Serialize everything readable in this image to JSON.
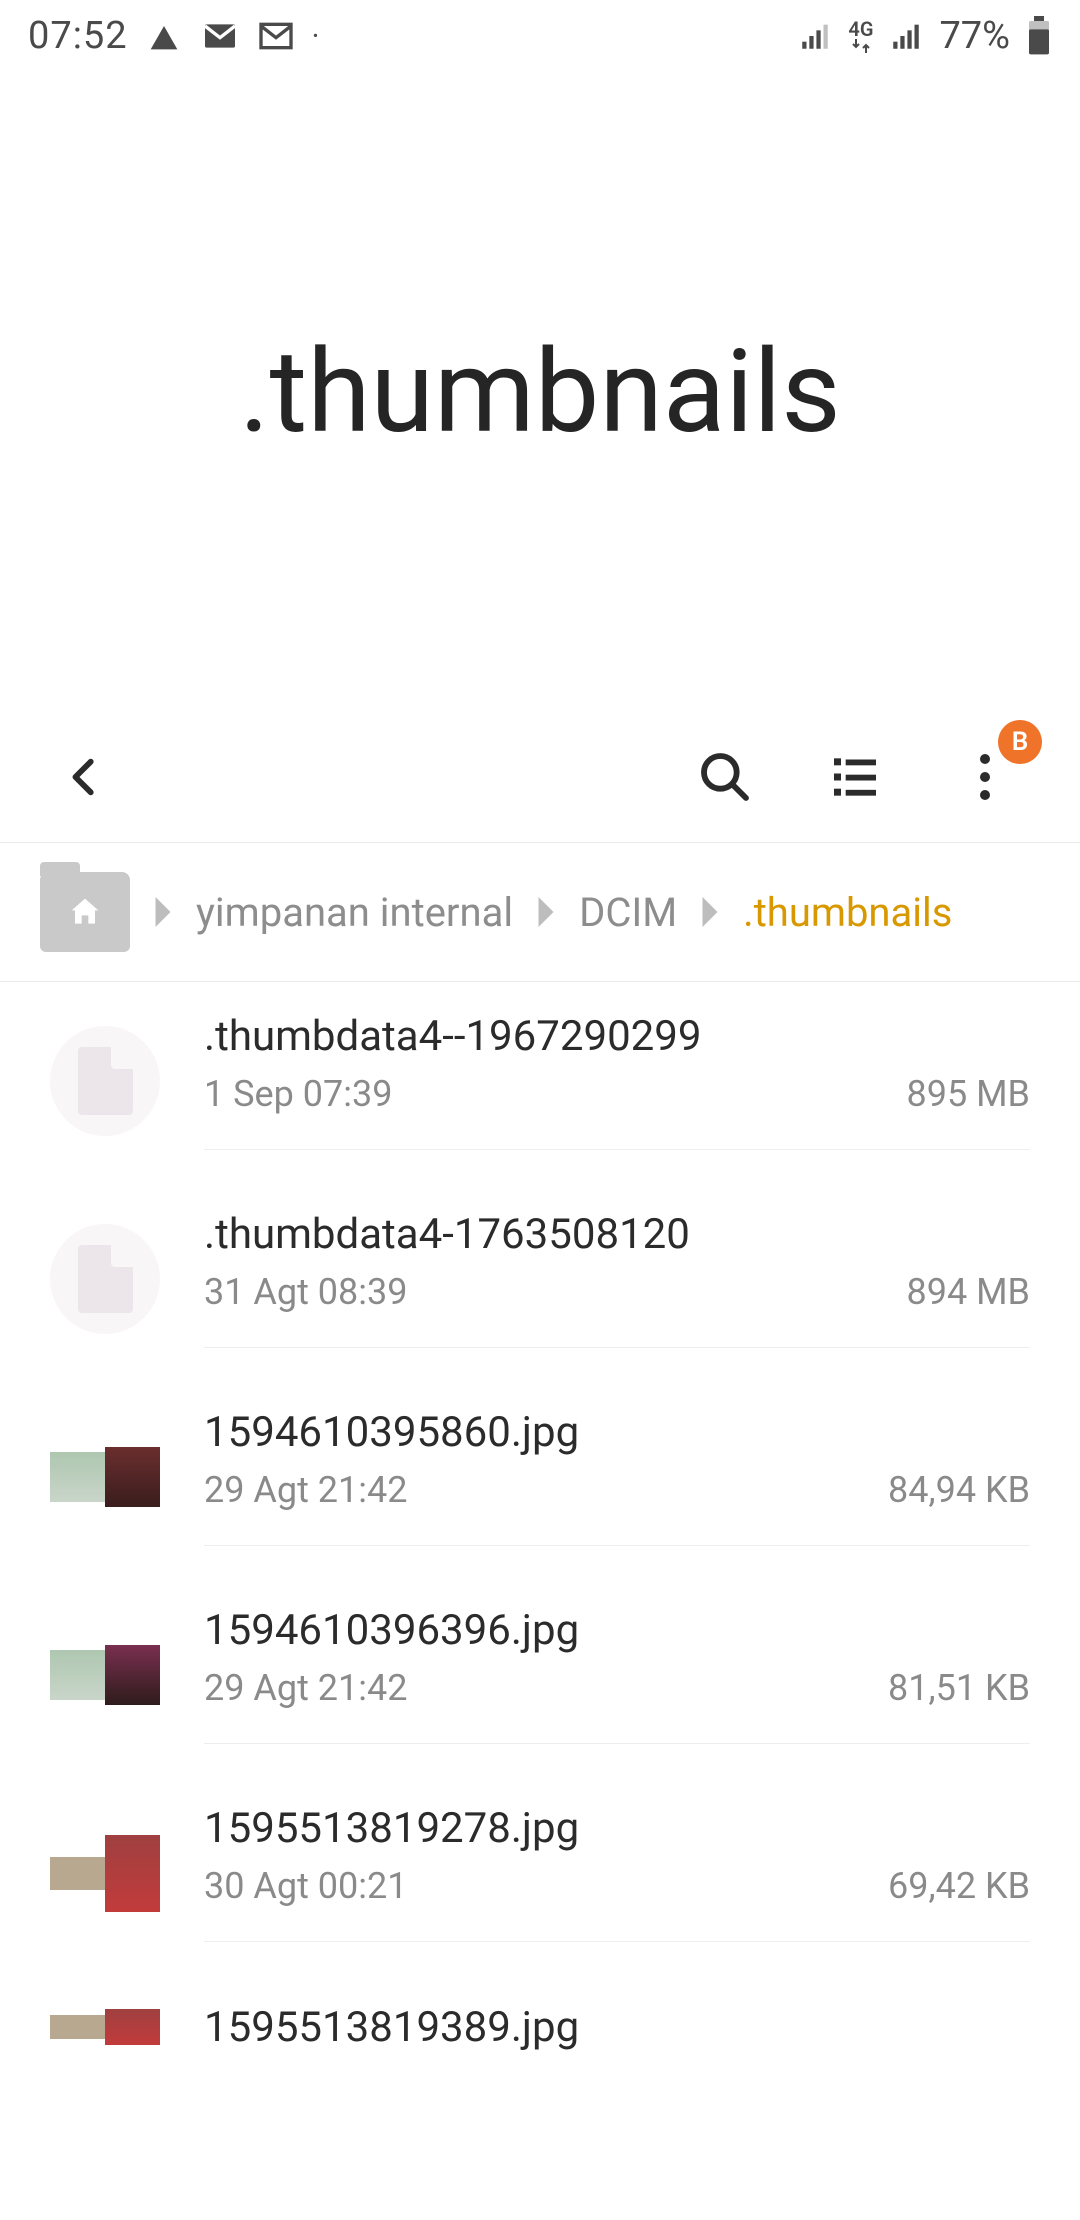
{
  "status_bar": {
    "time": "07:52",
    "network_label": "4G",
    "battery_pct": "77%"
  },
  "page_title": ".thumbnails",
  "badge_letter": "B",
  "breadcrumb": {
    "seg0": "yimpanan internal",
    "seg1": "DCIM",
    "seg2": ".thumbnails"
  },
  "files": [
    {
      "name": ".thumbdata4--1967290299",
      "date": "1 Sep 07:39",
      "size": "895 MB",
      "thumb": "doc"
    },
    {
      "name": ".thumbdata4-1763508120",
      "date": "31 Agt 08:39",
      "size": "894 MB",
      "thumb": "doc"
    },
    {
      "name": "1594610395860.jpg",
      "date": "29 Agt 21:42",
      "size": "84,94 KB",
      "thumb": "img-a"
    },
    {
      "name": "1594610396396.jpg",
      "date": "29 Agt 21:42",
      "size": "81,51 KB",
      "thumb": "img-b"
    },
    {
      "name": "1595513819278.jpg",
      "date": "30 Agt 00:21",
      "size": "69,42 KB",
      "thumb": "img-c"
    },
    {
      "name": "1595513819389.jpg",
      "date": "",
      "size": "",
      "thumb": "img-c"
    }
  ]
}
